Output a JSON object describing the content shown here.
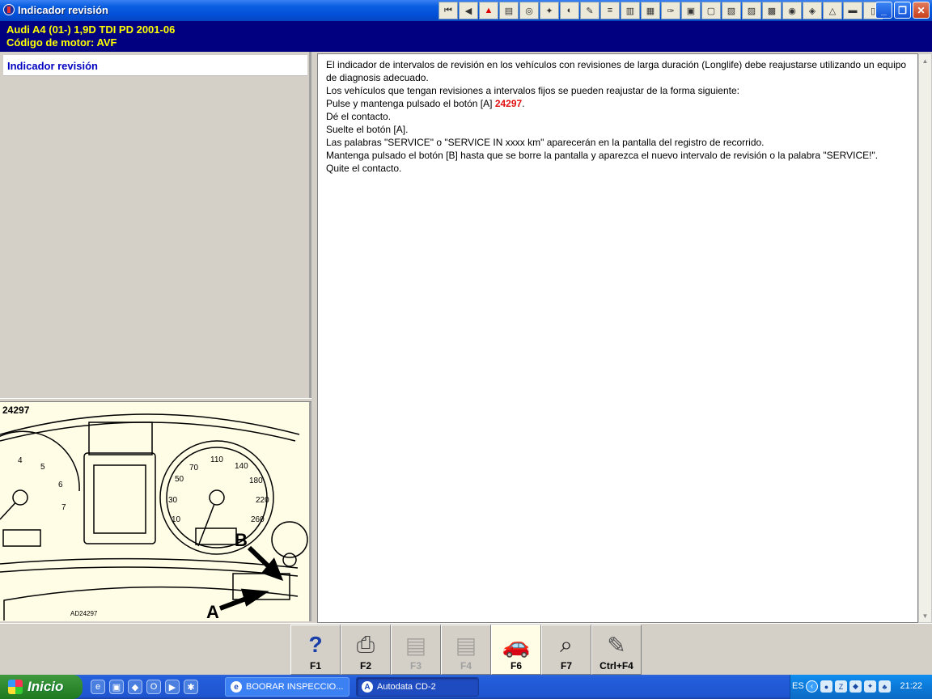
{
  "window": {
    "title": "Indicador revisión",
    "toolbar_icons": [
      "first-page-icon",
      "prev-page-icon",
      "warning-icon",
      "chart-icon",
      "component-icon",
      "tools-icon",
      "gauge-icon",
      "wrench-icon",
      "timing-icon",
      "engine-icon",
      "diagnostics-icon",
      "key-icon",
      "car-icon",
      "ecu-icon",
      "connector-icon",
      "repair-icon",
      "injection-icon",
      "brake-icon",
      "service-icon",
      "steering-icon",
      "ac-icon",
      "vehicle-icon",
      "doc-icon"
    ]
  },
  "header": {
    "vehicle": "Audi   A4 (01-) 1,9D TDI PD 2001-06",
    "engine": "Código de motor: AVF"
  },
  "sidebar": {
    "items": [
      {
        "label": "Indicador revisión"
      }
    ]
  },
  "figure": {
    "number": "24297",
    "code": "AD24297",
    "label_a": "A",
    "label_b": "B"
  },
  "content": {
    "p1": "El indicador de intervalos de revisión en los vehículos con revisiones de larga duración (Longlife) debe reajustarse utilizando un equipo de diagnosis adecuado.",
    "p2": "Los vehículos que tengan revisiones a intervalos fijos se pueden reajustar de la forma siguiente:",
    "p3_before": "Pulse y mantenga pulsado el botón [A] ",
    "p3_ref": "24297",
    "p3_after": ".",
    "p4": "Dé el contacto.",
    "p5": "Suelte el botón [A].",
    "p6": "Las palabras \"SERVICE\" o \"SERVICE IN xxxx km\" aparecerán en la pantalla del registro de recorrido.",
    "p7": "Mantenga pulsado el botón [B] hasta que se borre la pantalla y aparezca el nuevo intervalo de revisión o la palabra \"SERVICE!\".",
    "p8": "Quite el contacto."
  },
  "function_keys": [
    {
      "label": "F1",
      "icon": "help-icon",
      "state": "enabled"
    },
    {
      "label": "F2",
      "icon": "print-icon",
      "state": "enabled"
    },
    {
      "label": "F3",
      "icon": "pages-icon",
      "state": "disabled"
    },
    {
      "label": "F4",
      "icon": "pages-icon",
      "state": "disabled"
    },
    {
      "label": "F6",
      "icon": "car-service-icon",
      "state": "active"
    },
    {
      "label": "F7",
      "icon": "magnifier-icon",
      "state": "enabled"
    },
    {
      "label": "Ctrl+F4",
      "icon": "notes-icon",
      "state": "enabled"
    }
  ],
  "taskbar": {
    "start_label": "Inicio",
    "tasks": [
      {
        "label": "BOORAR INSPECCIO..."
      },
      {
        "label": "Autodata CD-2"
      }
    ],
    "language": "ES",
    "clock": "21:22"
  },
  "colors": {
    "header_bg": "#000080",
    "header_text": "#ffff00",
    "sidebar_item_text": "#0000c0",
    "reference_text": "#e01010",
    "figure_bg": "#fffde6"
  }
}
